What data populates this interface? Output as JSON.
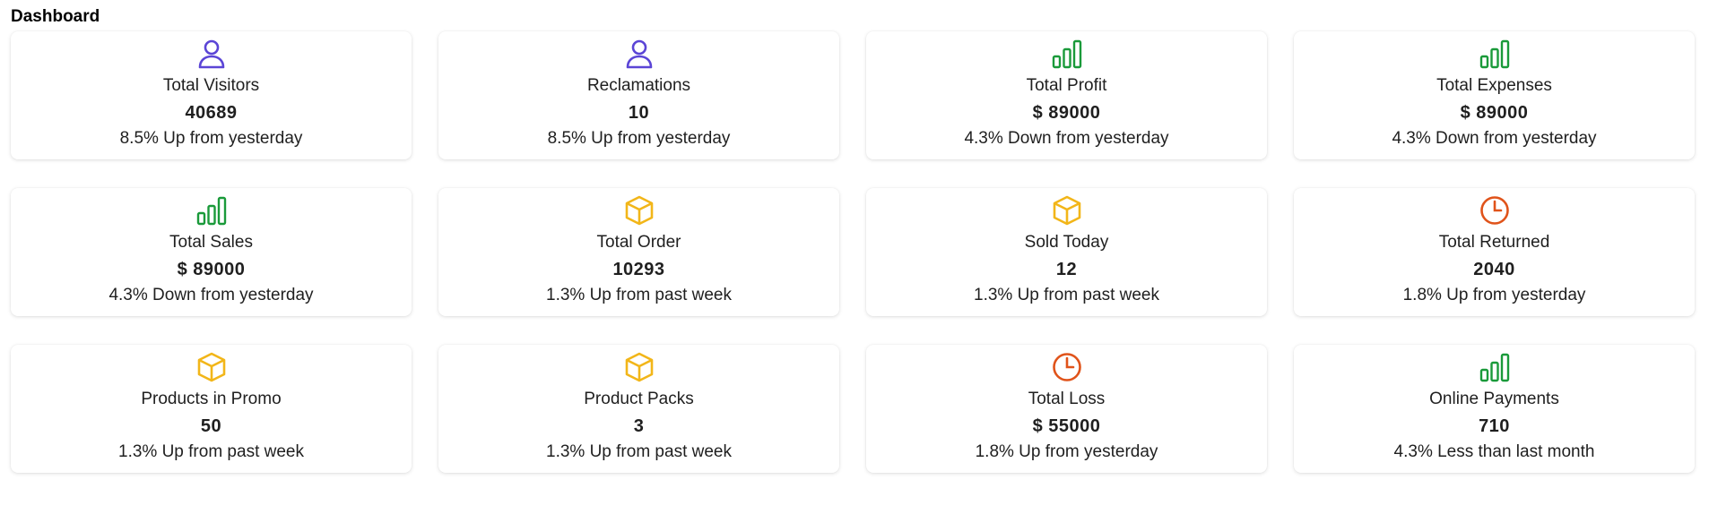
{
  "page": {
    "title": "Dashboard"
  },
  "colors": {
    "user": "#5b45d6",
    "chart": "#1a9a3a",
    "box": "#f2b619",
    "clock": "#e0531a"
  },
  "cards": [
    {
      "icon": "user-icon",
      "label": "Total Visitors",
      "value": "40689",
      "trend": "8.5% Up from yesterday"
    },
    {
      "icon": "user-icon",
      "label": "Reclamations",
      "value": "10",
      "trend": "8.5% Up from yesterday"
    },
    {
      "icon": "bar-chart-icon",
      "label": "Total Profit",
      "value": "$ 89000",
      "trend": "4.3% Down from yesterday"
    },
    {
      "icon": "bar-chart-icon",
      "label": "Total Expenses",
      "value": "$ 89000",
      "trend": "4.3% Down from yesterday"
    },
    {
      "icon": "bar-chart-icon",
      "label": "Total Sales",
      "value": "$ 89000",
      "trend": "4.3% Down from yesterday"
    },
    {
      "icon": "box-icon",
      "label": "Total Order",
      "value": "10293",
      "trend": "1.3% Up from past week"
    },
    {
      "icon": "box-icon",
      "label": "Sold Today",
      "value": "12",
      "trend": "1.3% Up from past week"
    },
    {
      "icon": "clock-icon",
      "label": "Total Returned",
      "value": "2040",
      "trend": "1.8% Up from yesterday"
    },
    {
      "icon": "box-icon",
      "label": "Products in Promo",
      "value": "50",
      "trend": "1.3% Up from past week"
    },
    {
      "icon": "box-icon",
      "label": "Product Packs",
      "value": "3",
      "trend": "1.3% Up from past week"
    },
    {
      "icon": "clock-icon",
      "label": "Total Loss",
      "value": "$ 55000",
      "trend": "1.8% Up from yesterday"
    },
    {
      "icon": "bar-chart-icon",
      "label": "Online Payments",
      "value": "710",
      "trend": "4.3% Less than last month"
    }
  ]
}
